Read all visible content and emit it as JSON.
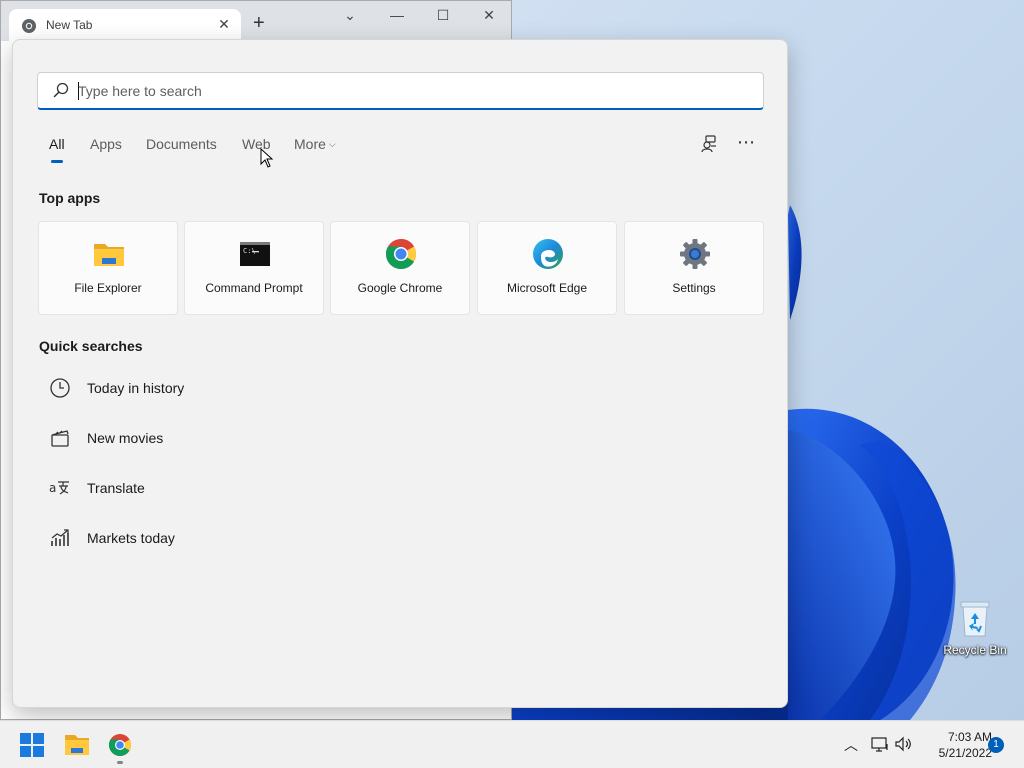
{
  "browser": {
    "tab_title": "New Tab",
    "tab_close": "✕",
    "new_tab": "+",
    "ctl_down": "⌄",
    "ctl_minimize": "—",
    "ctl_maximize": "☐",
    "ctl_close": "✕"
  },
  "search": {
    "placeholder": "Type here to search",
    "value": ""
  },
  "filters": [
    {
      "label": "All",
      "active": true
    },
    {
      "label": "Apps"
    },
    {
      "label": "Documents"
    },
    {
      "label": "Web"
    },
    {
      "label": "More",
      "chevron": "⌵"
    }
  ],
  "toolbar": {
    "more_options": "⋯"
  },
  "top_apps": {
    "title": "Top apps",
    "items": [
      {
        "label": "File Explorer",
        "icon": "folder-icon"
      },
      {
        "label": "Command Prompt",
        "icon": "terminal-icon"
      },
      {
        "label": "Google Chrome",
        "icon": "chrome-icon"
      },
      {
        "label": "Microsoft Edge",
        "icon": "edge-icon"
      },
      {
        "label": "Settings",
        "icon": "gear-icon"
      }
    ]
  },
  "quick_searches": {
    "title": "Quick searches",
    "items": [
      {
        "label": "Today in history",
        "icon": "clock-icon"
      },
      {
        "label": "New movies",
        "icon": "clapperboard-icon"
      },
      {
        "label": "Translate",
        "icon": "translate-icon"
      },
      {
        "label": "Markets today",
        "icon": "chart-icon"
      }
    ]
  },
  "desktop": {
    "recycle_bin": "Recycle Bin"
  },
  "taskbar": {
    "time": "7:03 AM",
    "date": "5/21/2022",
    "notification_count": "1",
    "tray_chevron": "︿"
  },
  "colors": {
    "accent": "#005fb8",
    "panel": "#f2f2f2",
    "taskbar": "#f0f0f0"
  }
}
